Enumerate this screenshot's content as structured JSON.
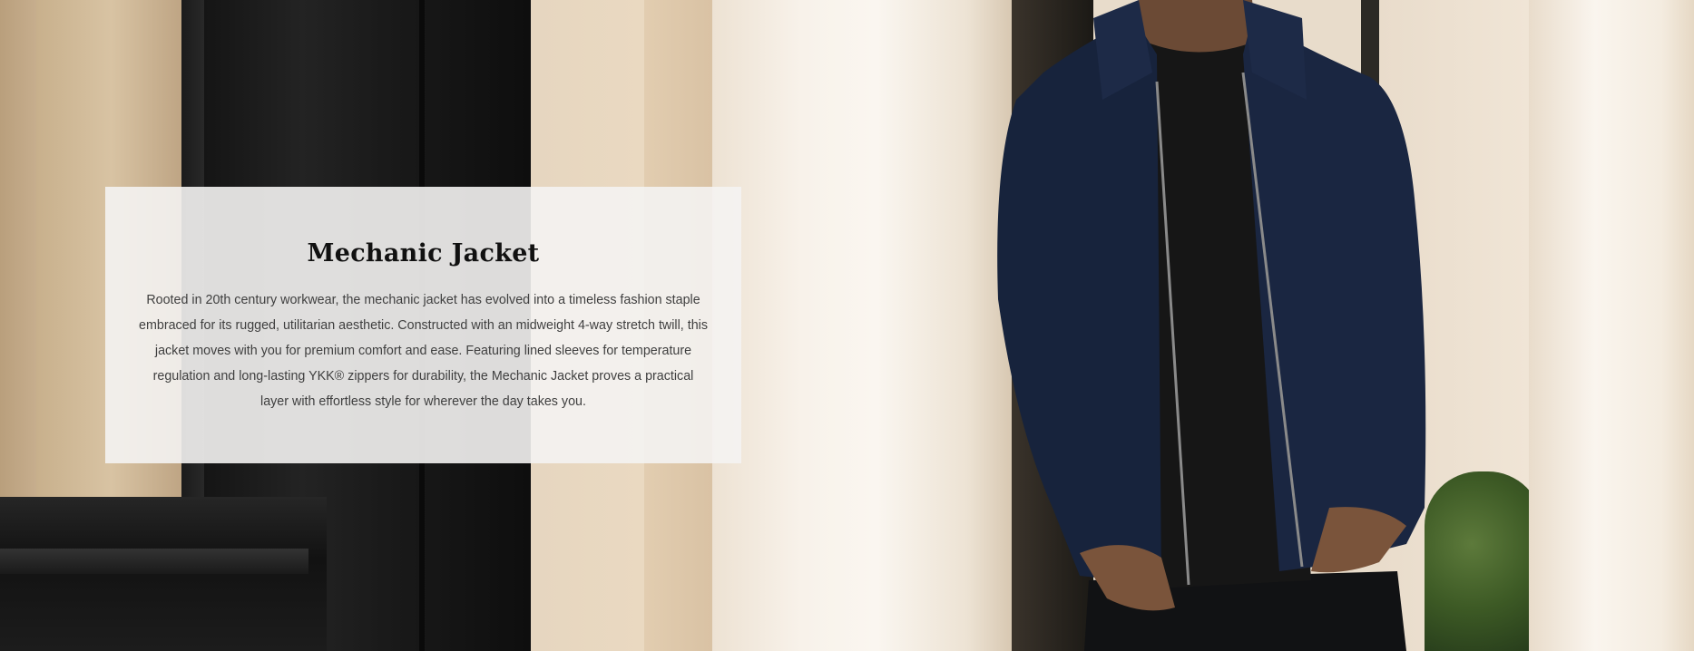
{
  "feature": {
    "title": "Mechanic Jacket",
    "description": "Rooted in 20th century workwear, the mechanic jacket has evolved into a timeless fashion staple embraced for its rugged, utilitarian aesthetic. Constructed with an midweight 4-way stretch twill, this jacket moves with you for premium comfort and ease. Featuring lined sleeves for temperature regulation and long-lasting YKK® zippers for durability, the Mechanic Jacket proves a practical layer with effortless style for wherever the day takes you."
  },
  "colors": {
    "card_background": "#f4f3f2",
    "title_text": "#111111",
    "body_text": "#3f3f3f",
    "jacket_navy": "#17233c",
    "tshirt_black": "#161616",
    "door_black": "#1a1a1a",
    "wall_cream": "#ead9c1"
  }
}
